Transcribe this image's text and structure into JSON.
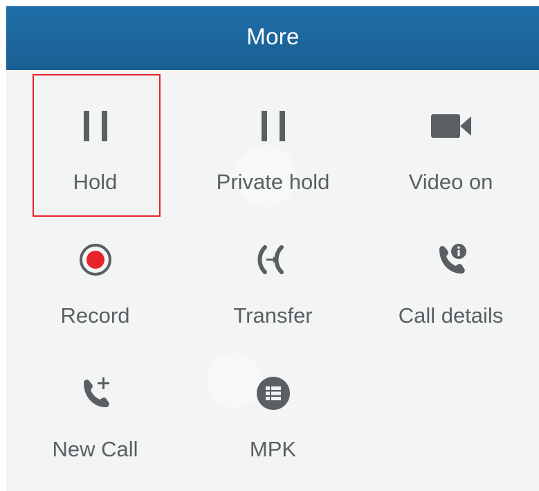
{
  "header": {
    "title": "More"
  },
  "items": [
    {
      "label": "Hold",
      "icon": "pause-icon"
    },
    {
      "label": "Private hold",
      "icon": "pause-icon"
    },
    {
      "label": "Video on",
      "icon": "video-camera-icon"
    },
    {
      "label": "Record",
      "icon": "record-icon"
    },
    {
      "label": "Transfer",
      "icon": "transfer-icon"
    },
    {
      "label": "Call details",
      "icon": "call-details-icon"
    },
    {
      "label": "New Call",
      "icon": "new-call-icon"
    },
    {
      "label": "MPK",
      "icon": "mpk-grid-icon"
    }
  ],
  "colors": {
    "header_bg": "#1a5f93",
    "icon_gray": "#5a5f63",
    "record_red": "#e8232a",
    "highlight": "#e8232a"
  }
}
